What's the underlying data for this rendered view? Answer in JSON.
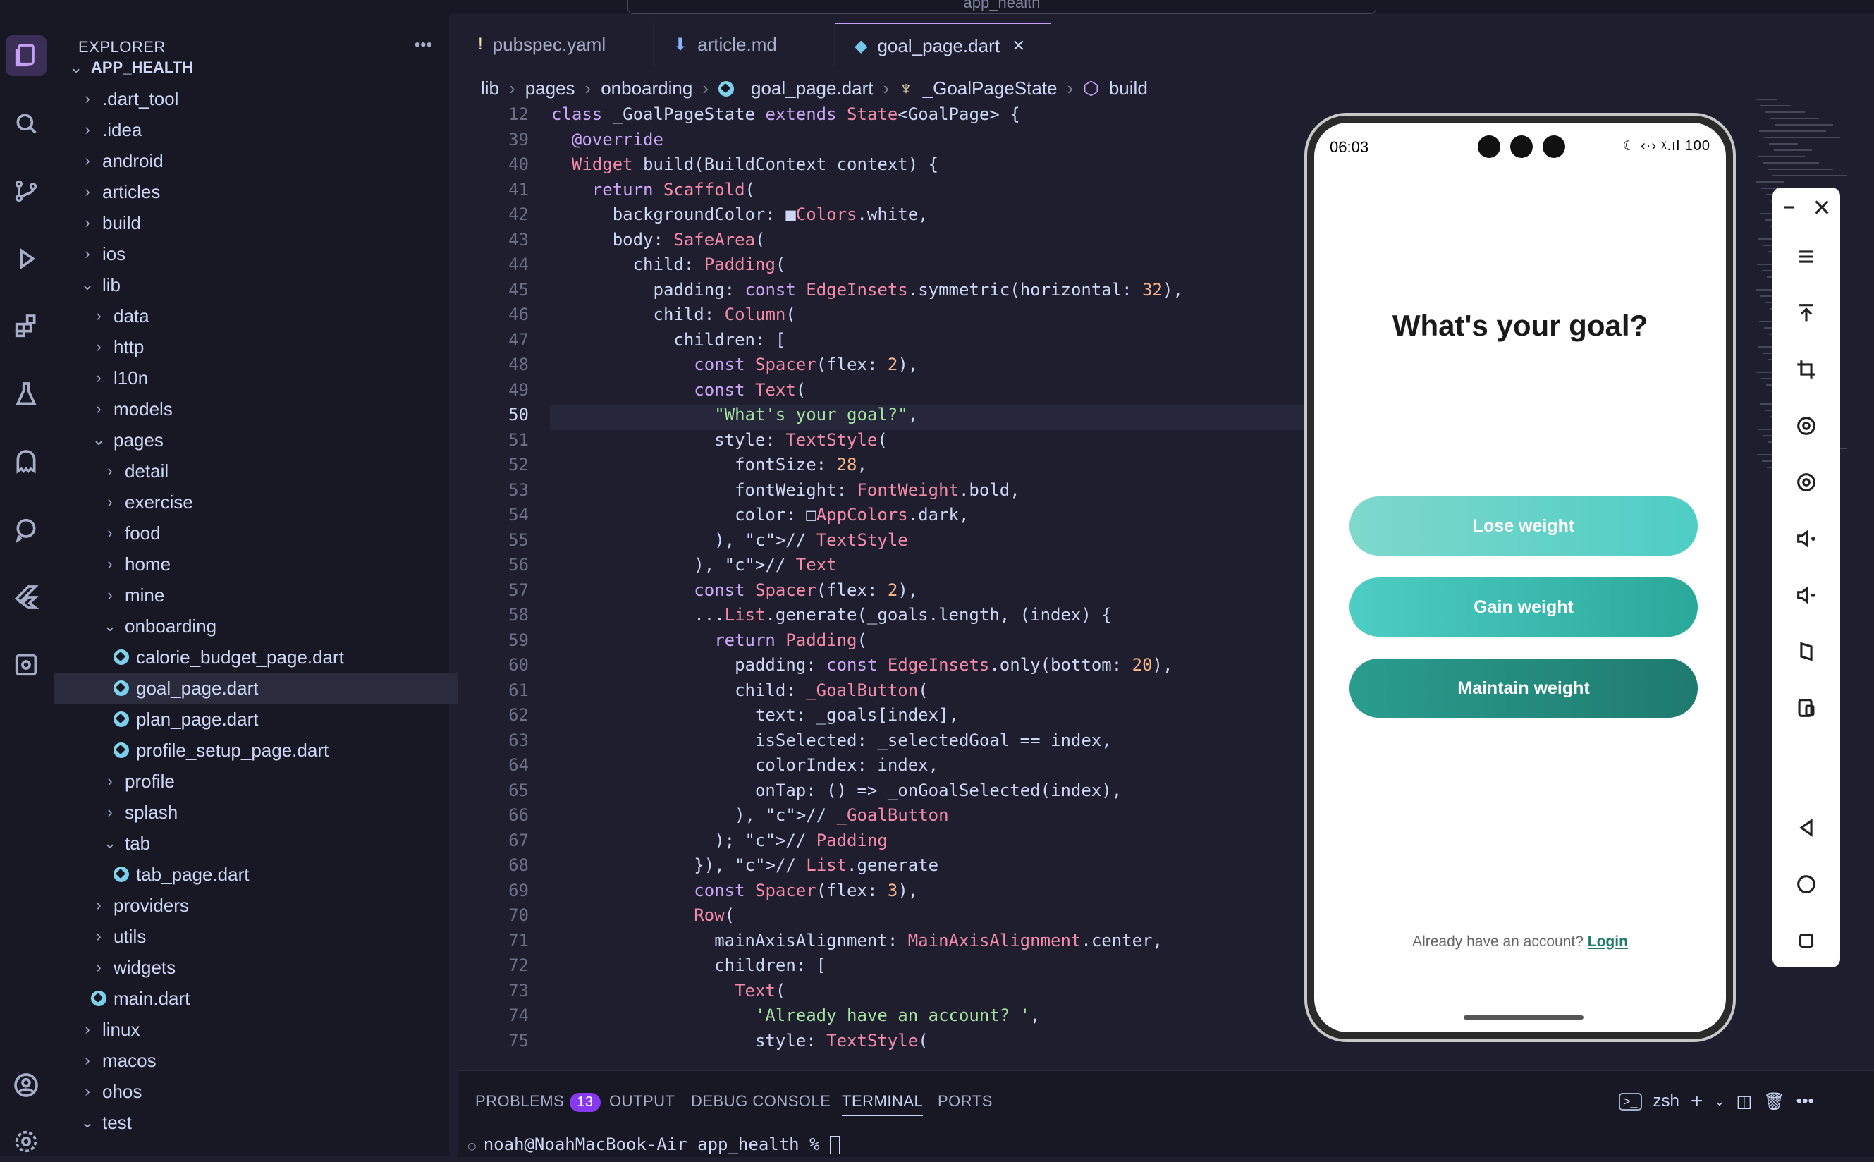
{
  "window": {
    "search_text": "app_health"
  },
  "sidebar": {
    "title": "EXPLORER",
    "more_icon": "ellipsis-icon",
    "tree": [
      {
        "label": "APP_HEALTH",
        "depth": 0,
        "kind": "root",
        "chevron": "down"
      },
      {
        "label": ".dart_tool",
        "depth": 1,
        "kind": "folder",
        "chevron": "right"
      },
      {
        "label": ".idea",
        "depth": 1,
        "kind": "folder",
        "chevron": "right"
      },
      {
        "label": "android",
        "depth": 1,
        "kind": "folder",
        "chevron": "right"
      },
      {
        "label": "articles",
        "depth": 1,
        "kind": "folder",
        "chevron": "right"
      },
      {
        "label": "build",
        "depth": 1,
        "kind": "folder",
        "chevron": "right"
      },
      {
        "label": "ios",
        "depth": 1,
        "kind": "folder",
        "chevron": "right"
      },
      {
        "label": "lib",
        "depth": 1,
        "kind": "folder",
        "chevron": "down"
      },
      {
        "label": "data",
        "depth": 2,
        "kind": "folder",
        "chevron": "right"
      },
      {
        "label": "http",
        "depth": 2,
        "kind": "folder",
        "chevron": "right"
      },
      {
        "label": "l10n",
        "depth": 2,
        "kind": "folder",
        "chevron": "right"
      },
      {
        "label": "models",
        "depth": 2,
        "kind": "folder",
        "chevron": "right"
      },
      {
        "label": "pages",
        "depth": 2,
        "kind": "folder",
        "chevron": "down"
      },
      {
        "label": "detail",
        "depth": 3,
        "kind": "folder",
        "chevron": "right"
      },
      {
        "label": "exercise",
        "depth": 3,
        "kind": "folder",
        "chevron": "right"
      },
      {
        "label": "food",
        "depth": 3,
        "kind": "folder",
        "chevron": "right"
      },
      {
        "label": "home",
        "depth": 3,
        "kind": "folder",
        "chevron": "right"
      },
      {
        "label": "mine",
        "depth": 3,
        "kind": "folder",
        "chevron": "right"
      },
      {
        "label": "onboarding",
        "depth": 3,
        "kind": "folder",
        "chevron": "down"
      },
      {
        "label": "calorie_budget_page.dart",
        "depth": 4,
        "kind": "dart"
      },
      {
        "label": "goal_page.dart",
        "depth": 4,
        "kind": "dart",
        "selected": true
      },
      {
        "label": "plan_page.dart",
        "depth": 4,
        "kind": "dart"
      },
      {
        "label": "profile_setup_page.dart",
        "depth": 4,
        "kind": "dart"
      },
      {
        "label": "profile",
        "depth": 3,
        "kind": "folder",
        "chevron": "right"
      },
      {
        "label": "splash",
        "depth": 3,
        "kind": "folder",
        "chevron": "right"
      },
      {
        "label": "tab",
        "depth": 3,
        "kind": "folder",
        "chevron": "down"
      },
      {
        "label": "tab_page.dart",
        "depth": 4,
        "kind": "dart"
      },
      {
        "label": "providers",
        "depth": 2,
        "kind": "folder",
        "chevron": "right"
      },
      {
        "label": "utils",
        "depth": 2,
        "kind": "folder",
        "chevron": "right"
      },
      {
        "label": "widgets",
        "depth": 2,
        "kind": "folder",
        "chevron": "right"
      },
      {
        "label": "main.dart",
        "depth": 2,
        "kind": "dart"
      },
      {
        "label": "linux",
        "depth": 1,
        "kind": "folder",
        "chevron": "right"
      },
      {
        "label": "macos",
        "depth": 1,
        "kind": "folder",
        "chevron": "right"
      },
      {
        "label": "ohos",
        "depth": 1,
        "kind": "folder",
        "chevron": "right"
      },
      {
        "label": "test",
        "depth": 1,
        "kind": "folder",
        "chevron": "down"
      }
    ]
  },
  "tabs": [
    {
      "label": "pubspec.yaml",
      "mark": "!",
      "active": false
    },
    {
      "label": "article.md",
      "mark": "⬇",
      "active": false
    },
    {
      "label": "goal_page.dart",
      "mark": "◆",
      "active": true,
      "close": "×"
    }
  ],
  "breadcrumb": [
    "lib",
    "pages",
    "onboarding",
    "goal_page.dart",
    "_GoalPageState",
    "build"
  ],
  "code": {
    "current_line": 50,
    "lines": [
      {
        "n": 12,
        "t": "class _GoalPageState extends State<GoalPage> {"
      },
      {
        "n": 39,
        "t": "  @override"
      },
      {
        "n": 40,
        "t": "  Widget build(BuildContext context) {"
      },
      {
        "n": 41,
        "t": "    return Scaffold("
      },
      {
        "n": 42,
        "t": "      backgroundColor: ■Colors.white,"
      },
      {
        "n": 43,
        "t": "      body: SafeArea("
      },
      {
        "n": 44,
        "t": "        child: Padding("
      },
      {
        "n": 45,
        "t": "          padding: const EdgeInsets.symmetric(horizontal: 32),"
      },
      {
        "n": 46,
        "t": "          child: Column("
      },
      {
        "n": 47,
        "t": "            children: ["
      },
      {
        "n": 48,
        "t": "              const Spacer(flex: 2),"
      },
      {
        "n": 49,
        "t": "              const Text("
      },
      {
        "n": 50,
        "t": "                \"What's your goal?\","
      },
      {
        "n": 51,
        "t": "                style: TextStyle("
      },
      {
        "n": 52,
        "t": "                  fontSize: 28,"
      },
      {
        "n": 53,
        "t": "                  fontWeight: FontWeight.bold,"
      },
      {
        "n": 54,
        "t": "                  color: □AppColors.dark,"
      },
      {
        "n": 55,
        "t": "                ), // TextStyle"
      },
      {
        "n": 56,
        "t": "              ), // Text"
      },
      {
        "n": 57,
        "t": "              const Spacer(flex: 2),"
      },
      {
        "n": 58,
        "t": "              ...List.generate(_goals.length, (index) {"
      },
      {
        "n": 59,
        "t": "                return Padding("
      },
      {
        "n": 60,
        "t": "                  padding: const EdgeInsets.only(bottom: 20),"
      },
      {
        "n": 61,
        "t": "                  child: _GoalButton("
      },
      {
        "n": 62,
        "t": "                    text: _goals[index],"
      },
      {
        "n": 63,
        "t": "                    isSelected: _selectedGoal == index,"
      },
      {
        "n": 64,
        "t": "                    colorIndex: index,"
      },
      {
        "n": 65,
        "t": "                    onTap: () => _onGoalSelected(index),"
      },
      {
        "n": 66,
        "t": "                  ), // _GoalButton"
      },
      {
        "n": 67,
        "t": "                ); // Padding"
      },
      {
        "n": 68,
        "t": "              }), // List.generate"
      },
      {
        "n": 69,
        "t": "              const Spacer(flex: 3),"
      },
      {
        "n": 70,
        "t": "              Row("
      },
      {
        "n": 71,
        "t": "                mainAxisAlignment: MainAxisAlignment.center,"
      },
      {
        "n": 72,
        "t": "                children: ["
      },
      {
        "n": 73,
        "t": "                  Text("
      },
      {
        "n": 74,
        "t": "                    'Already have an account? ',"
      },
      {
        "n": 75,
        "t": "                    style: TextStyle("
      }
    ]
  },
  "phone": {
    "time": "06:03",
    "status": "☾ ‹·› ᵡ.ıl 100",
    "title": "What's your goal?",
    "buttons": [
      "Lose weight",
      "Gain weight",
      "Maintain weight"
    ],
    "account_text": "Already have an account? ",
    "login_label": "Login"
  },
  "emulator_tools": [
    "minimize-icon",
    "close-icon",
    "menu-icon",
    "pin-top-icon",
    "crop-icon",
    "rotate-icon",
    "screenshot-icon",
    "volume-up-icon",
    "volume-down-icon",
    "fold-icon",
    "device-icon",
    "back-icon",
    "home-icon",
    "overview-icon"
  ],
  "panel": {
    "tabs": [
      "PROBLEMS",
      "OUTPUT",
      "DEBUG CONSOLE",
      "TERMINAL",
      "PORTS"
    ],
    "problems_count": "13",
    "active_tab": "TERMINAL",
    "shell": "zsh",
    "prompt": "noah@NoahMacBook-Air app_health % "
  },
  "colors": {
    "accent": "#c6a0f6",
    "btn1": "#4ecdc4",
    "btn2": "#2aa89a",
    "btn3": "#1f7a6e"
  }
}
